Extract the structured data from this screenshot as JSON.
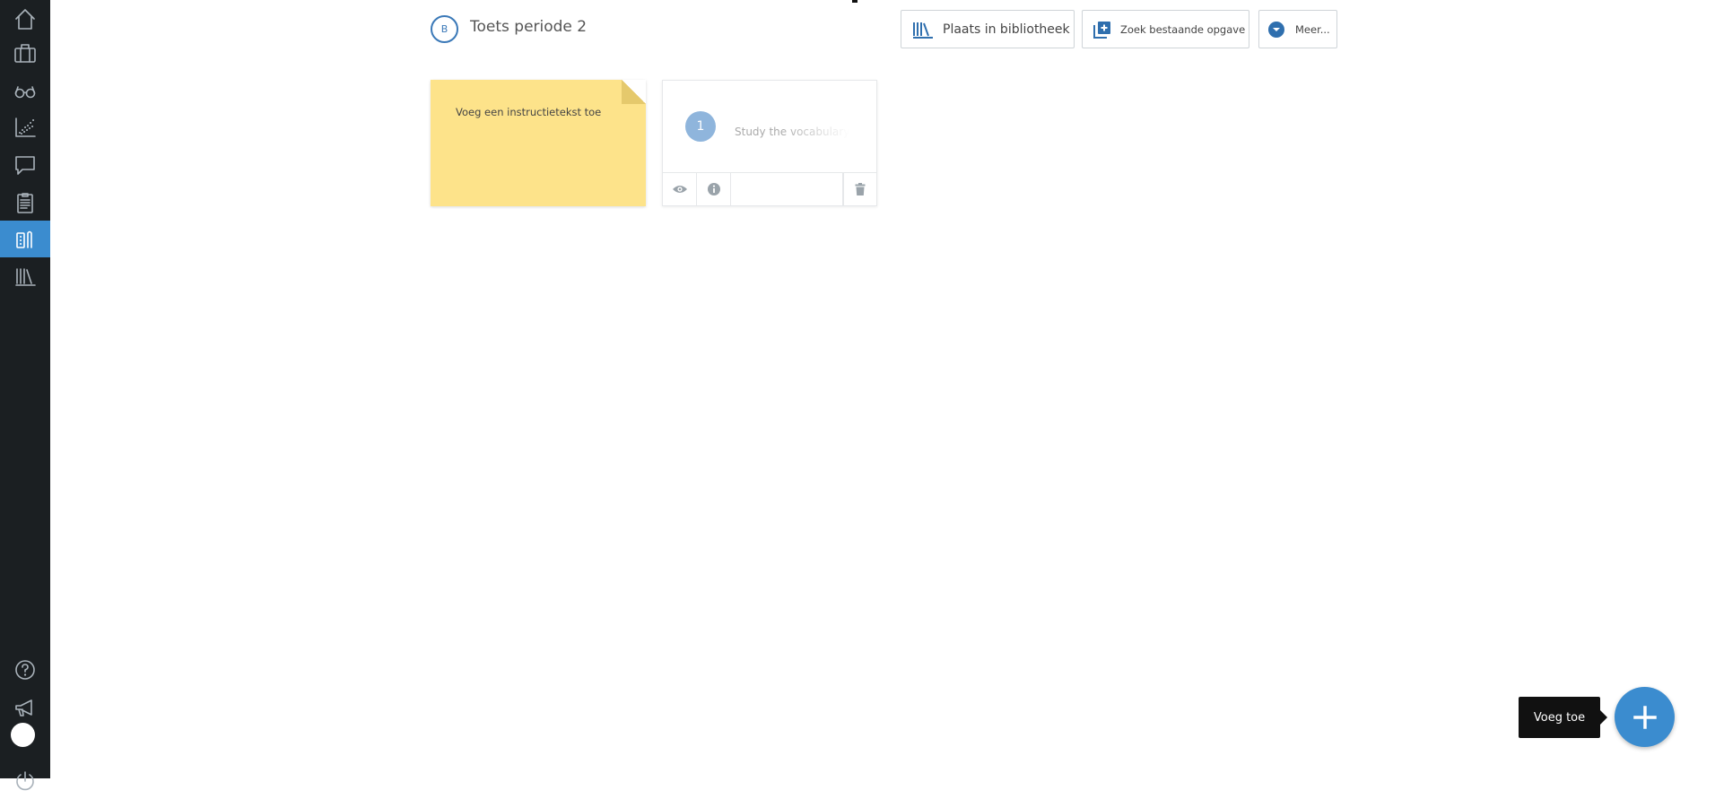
{
  "sidebar": {
    "items": [
      {
        "icon": "home-icon"
      },
      {
        "icon": "briefcase-icon"
      },
      {
        "icon": "glasses-icon"
      },
      {
        "icon": "chart-icon"
      },
      {
        "icon": "chat-icon"
      },
      {
        "icon": "clipboard-icon"
      },
      {
        "icon": "tasks-icon",
        "active": true
      },
      {
        "icon": "library-icon"
      }
    ],
    "bottom_items": [
      {
        "icon": "help-icon"
      },
      {
        "icon": "megaphone-icon"
      },
      {
        "icon": "avatar"
      },
      {
        "icon": "power-icon"
      }
    ],
    "active_color": "#3b8ccf",
    "background": "#1b1f22"
  },
  "header": {
    "badge": "B",
    "title": "Toets periode 2"
  },
  "toolbar": {
    "library_label": "Plaats in bibliotheek",
    "find_label": "Zoek bestaande opgave",
    "more_label": "Meer..."
  },
  "cards": {
    "note": {
      "text": "Voeg een instructietekst toe",
      "color": "#fde38a"
    },
    "task": {
      "number": "1",
      "title": "Study the vocabulary",
      "actions": [
        "eye-icon",
        "info-icon",
        "trash-icon"
      ]
    }
  },
  "fab": {
    "tooltip": "Voeg toe",
    "icon": "plus-icon",
    "color": "#3b8ccf"
  }
}
